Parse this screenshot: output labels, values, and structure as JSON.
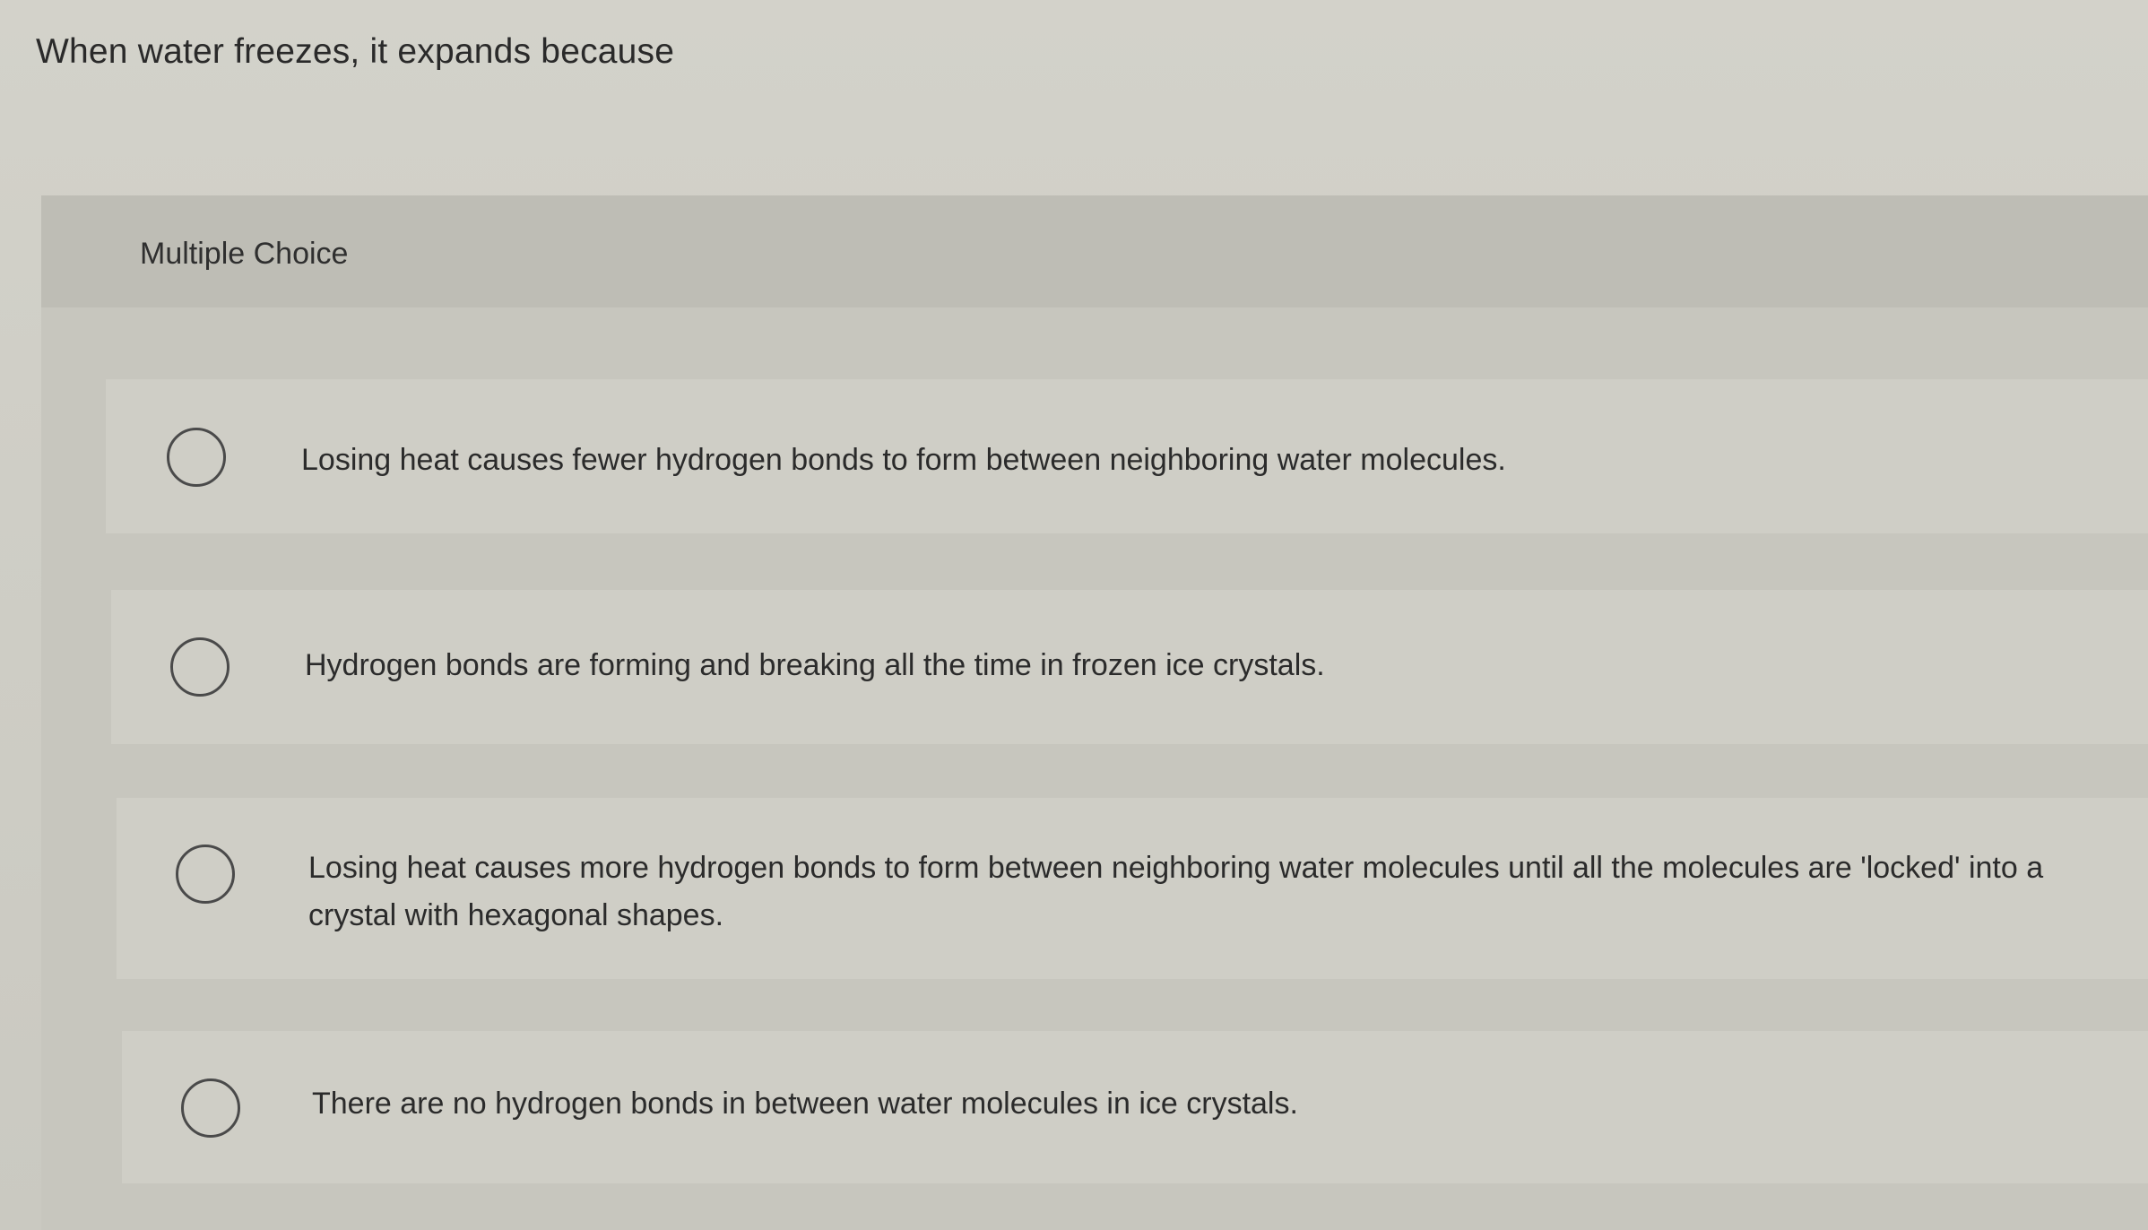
{
  "question": {
    "text": "When water freezes, it expands because"
  },
  "panel": {
    "title": "Multiple Choice"
  },
  "options": [
    {
      "text": "Losing heat causes fewer hydrogen bonds to form between neighboring water molecules."
    },
    {
      "text": "Hydrogen bonds are forming and breaking all the time in frozen ice crystals."
    },
    {
      "text": "Losing heat causes more hydrogen bonds to form between neighboring water molecules until all the molecules are 'locked' into a crystal with hexagonal shapes."
    },
    {
      "text": "There are no hydrogen bonds in between water molecules in ice crystals."
    }
  ]
}
